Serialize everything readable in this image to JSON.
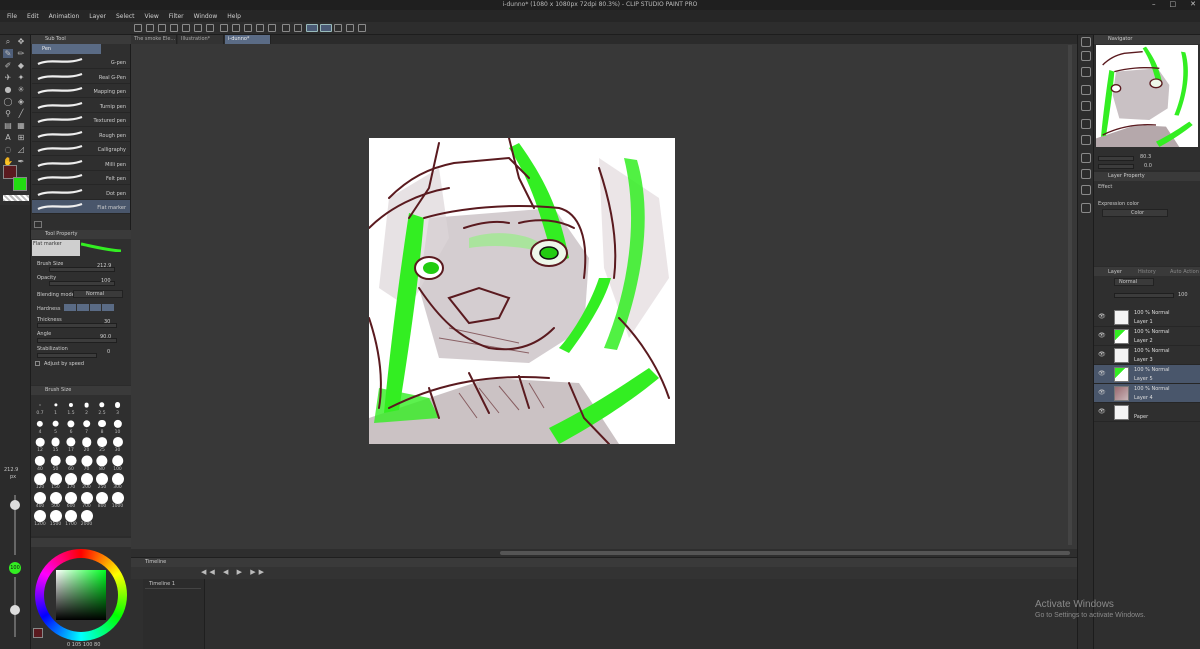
{
  "window": {
    "title": "i-dunno* (1080 x 1080px 72dpi 80.3%) - CLIP STUDIO PAINT PRO",
    "controls": [
      "–",
      "□",
      "✕"
    ]
  },
  "menu": [
    "File",
    "Edit",
    "Animation",
    "Layer",
    "Select",
    "View",
    "Filter",
    "Window",
    "Help"
  ],
  "tabs": [
    {
      "label": "The smoke Ele..."
    },
    {
      "label": "Illustration*"
    },
    {
      "label": "i-dunno*"
    }
  ],
  "subtool": {
    "header": "Sub Tool",
    "group": "Pen",
    "brushes": [
      "G-pen",
      "Real G-Pen",
      "Mapping pen",
      "Turnip pen",
      "Textured pen",
      "Rough pen",
      "Calligraphy",
      "Milli pen",
      "Felt pen",
      "Dot pen",
      "Flat marker"
    ]
  },
  "tool_property": {
    "header": "Tool Property",
    "preset": "Flat marker",
    "brush_size_label": "Brush Size",
    "brush_size_value": "212.9",
    "opacity_label": "Opacity",
    "opacity_value": "100",
    "blending_label": "Blending mode",
    "blending_value": "Normal",
    "hardness_label": "Hardness",
    "thickness_label": "Thickness",
    "thickness_value": "30",
    "angle_label": "Angle",
    "angle_value": "90.0",
    "stabilization_label": "Stabilization",
    "stabilization_value": "0",
    "adjust_speed": "Adjust by speed"
  },
  "brush_size_palette": {
    "header": "Brush Size",
    "sizes": [
      "0.7",
      "1",
      "1.5",
      "2",
      "2.5",
      "3",
      "4",
      "5",
      "6",
      "7",
      "8",
      "10",
      "12",
      "15",
      "17",
      "20",
      "25",
      "30",
      "40",
      "50",
      "60",
      "70",
      "80",
      "100",
      "120",
      "150",
      "170",
      "200",
      "250",
      "300",
      "400",
      "500",
      "600",
      "700",
      "800",
      "1000",
      "1200",
      "1500",
      "1700",
      "2000"
    ]
  },
  "left_readout": {
    "size": "212.9",
    "unit": "px",
    "opacity": "100"
  },
  "color_values": "0  105  100  80",
  "colors": {
    "main": "#5a1a1f",
    "sub": "#22dd11",
    "accent_green": "#33ee22",
    "brown": "#5a1a1f"
  },
  "timeline": {
    "header": "Timeline",
    "track": "Timeline 1"
  },
  "navigator": {
    "header": "Navigator",
    "zoom": "80.3",
    "angle": "0.0"
  },
  "layer_property": {
    "header": "Layer Property",
    "effect": "Effect",
    "expression_color_label": "Expression color",
    "expression_color_value": "Color"
  },
  "layer_panel": {
    "tabs": [
      "Layer",
      "History",
      "Auto Action"
    ],
    "blend": "Normal",
    "opacity": "100",
    "layers": [
      {
        "mode": "100 % Normal",
        "name": "Layer 1",
        "selected": false
      },
      {
        "mode": "100 % Normal",
        "name": "Layer 2",
        "selected": false
      },
      {
        "mode": "100 % Normal",
        "name": "Layer 3",
        "selected": false
      },
      {
        "mode": "100 % Normal",
        "name": "Layer 5",
        "selected": true
      },
      {
        "mode": "100 % Normal",
        "name": "Layer 4",
        "selected": true
      },
      {
        "mode": "",
        "name": "Paper",
        "selected": false
      }
    ]
  },
  "activate_windows": {
    "title": "Activate Windows",
    "subtitle": "Go to Settings to activate Windows."
  }
}
